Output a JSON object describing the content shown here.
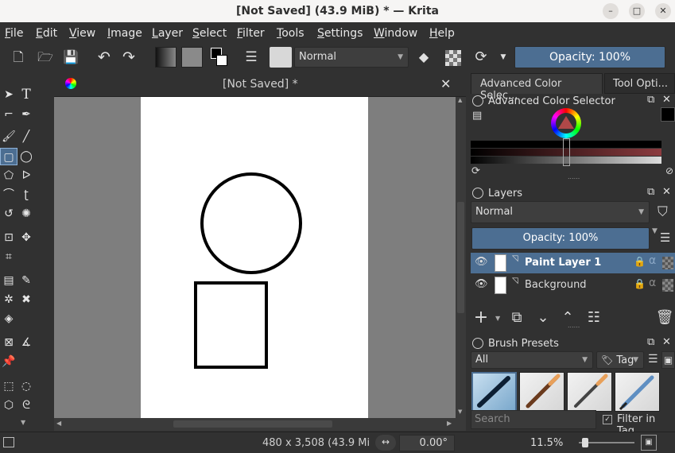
{
  "window": {
    "title": "[Not Saved]  (43.9 MiB)  * — Krita",
    "minimize": "–",
    "maximize": "□",
    "close": "✕"
  },
  "menu": [
    "File",
    "Edit",
    "View",
    "Image",
    "Layer",
    "Select",
    "Filter",
    "Tools",
    "Settings",
    "Window",
    "Help"
  ],
  "toolbar": {
    "blend_mode": "Normal",
    "opacity": "Opacity: 100%"
  },
  "document": {
    "tab_title": "[Not Saved]  *",
    "close": "✕"
  },
  "docker_tabs": [
    "Advanced Color Selec...",
    "Tool Opti..."
  ],
  "color_selector": {
    "title": "Advanced Color Selector",
    "dots": "......"
  },
  "layers": {
    "title": "Layers",
    "blend_mode": "Normal",
    "opacity": "Opacity:  100%",
    "items": [
      {
        "name": "Paint Layer 1",
        "selected": true
      },
      {
        "name": "Background",
        "selected": false
      }
    ],
    "dots": "......"
  },
  "brushes": {
    "title": "Brush Presets",
    "filter": "All",
    "tag": "Tag",
    "search_placeholder": "Search",
    "filter_in_tag": "Filter in Tag"
  },
  "status": {
    "size": "480 x 3,508 (43.9 Mi",
    "rotation": "0.00°",
    "zoom": "11.5%"
  },
  "colors": {
    "accent": "#4c6e92",
    "background": "#313131",
    "canvas": "#7e7e7e"
  }
}
